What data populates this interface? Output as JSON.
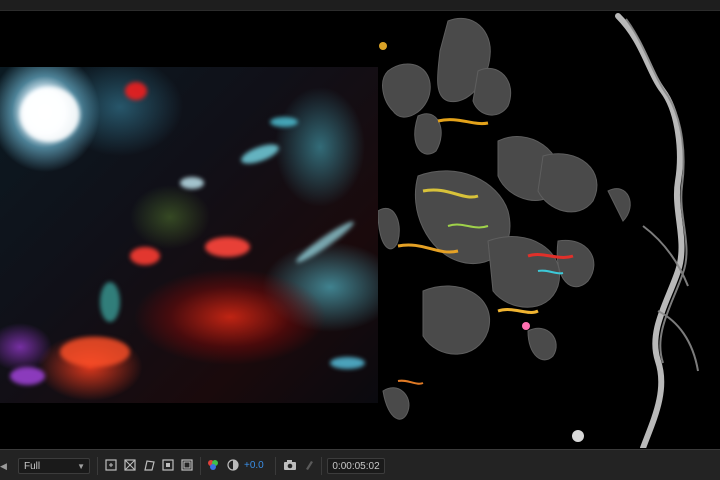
{
  "viewer": {
    "resolution": {
      "value": "Full"
    },
    "exposure": {
      "value": "+0.0"
    },
    "timecode": {
      "value": "0:00:05:02"
    }
  },
  "toolbar_icons": [
    "region-of-interest-icon",
    "transparency-grid-icon",
    "mask-visibility-icon",
    "guides-icon",
    "channels-icon",
    "color-management-icon",
    "snapshot-icon",
    "show-snapshot-icon"
  ],
  "colors": {
    "panel_bg": "#232323",
    "accent_blue": "#3a8ee6",
    "text": "#c8c8c8"
  }
}
